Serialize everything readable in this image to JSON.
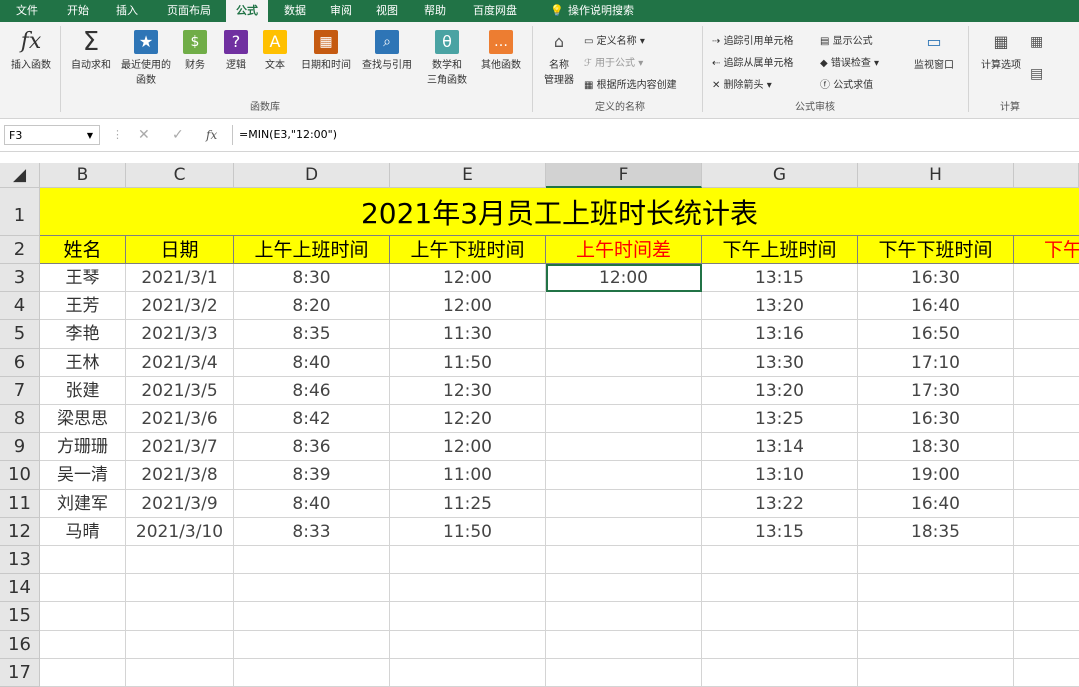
{
  "ribbon_tabs": [
    "文件",
    "开始",
    "插入",
    "页面布局",
    "公式",
    "数据",
    "审阅",
    "视图",
    "帮助",
    "百度网盘",
    "操作说明搜索"
  ],
  "active_tab": "公式",
  "ribbon": {
    "insert_function": "插入函数",
    "autosum": "自动求和",
    "recent": "最近使用的",
    "recent2": "函数",
    "finance": "财务",
    "logic": "逻辑",
    "text": "文本",
    "datetime": "日期和时间",
    "lookup": "查找与引用",
    "math": "数学和",
    "math2": "三角函数",
    "other": "其他函数",
    "group_library": "函数库",
    "name_manager": "名称",
    "name_manager2": "管理器",
    "define_name": "定义名称",
    "use_in_formula": "用于公式",
    "create_from_selection": "根据所选内容创建",
    "group_names": "定义的名称",
    "trace_precedents": "追踪引用单元格",
    "trace_dependents": "追踪从属单元格",
    "remove_arrows": "删除箭头",
    "show_formulas": "显示公式",
    "error_checking": "错误检查",
    "evaluate_formula": "公式求值",
    "watch_window": "监视窗口",
    "group_audit": "公式审核",
    "calc_options": "计算选项",
    "group_calc": "计算"
  },
  "namebox": "F3",
  "fx": "fx",
  "formula": "=MIN(E3,\"12:00\")",
  "columns": [
    "B",
    "C",
    "D",
    "E",
    "F",
    "G",
    "H"
  ],
  "rows": [
    "1",
    "2",
    "3",
    "4",
    "5",
    "6",
    "7",
    "8",
    "9",
    "10",
    "11",
    "12",
    "13",
    "14",
    "15",
    "16",
    "17"
  ],
  "title": "2021年3月员工上班时长统计表",
  "headers": [
    "姓名",
    "日期",
    "上午上班时间",
    "上午下班时间",
    "上午时间差",
    "下午上班时间",
    "下午下班时间",
    "下午"
  ],
  "accent_red": "#ff0000",
  "data_rows": [
    [
      "王琴",
      "2021/3/1",
      "8:30",
      "12:00",
      "12:00",
      "13:15",
      "16:30"
    ],
    [
      "王芳",
      "2021/3/2",
      "8:20",
      "12:00",
      "",
      "13:20",
      "16:40"
    ],
    [
      "李艳",
      "2021/3/3",
      "8:35",
      "11:30",
      "",
      "13:16",
      "16:50"
    ],
    [
      "王林",
      "2021/3/4",
      "8:40",
      "11:50",
      "",
      "13:30",
      "17:10"
    ],
    [
      "张建",
      "2021/3/5",
      "8:46",
      "12:30",
      "",
      "13:20",
      "17:30"
    ],
    [
      "梁思思",
      "2021/3/6",
      "8:42",
      "12:20",
      "",
      "13:25",
      "16:30"
    ],
    [
      "方珊珊",
      "2021/3/7",
      "8:36",
      "12:00",
      "",
      "13:14",
      "18:30"
    ],
    [
      "吴一清",
      "2021/3/8",
      "8:39",
      "11:00",
      "",
      "13:10",
      "19:00"
    ],
    [
      "刘建军",
      "2021/3/9",
      "8:40",
      "11:25",
      "",
      "13:22",
      "16:40"
    ],
    [
      "马晴",
      "2021/3/10",
      "8:33",
      "11:50",
      "",
      "13:15",
      "18:35"
    ]
  ]
}
